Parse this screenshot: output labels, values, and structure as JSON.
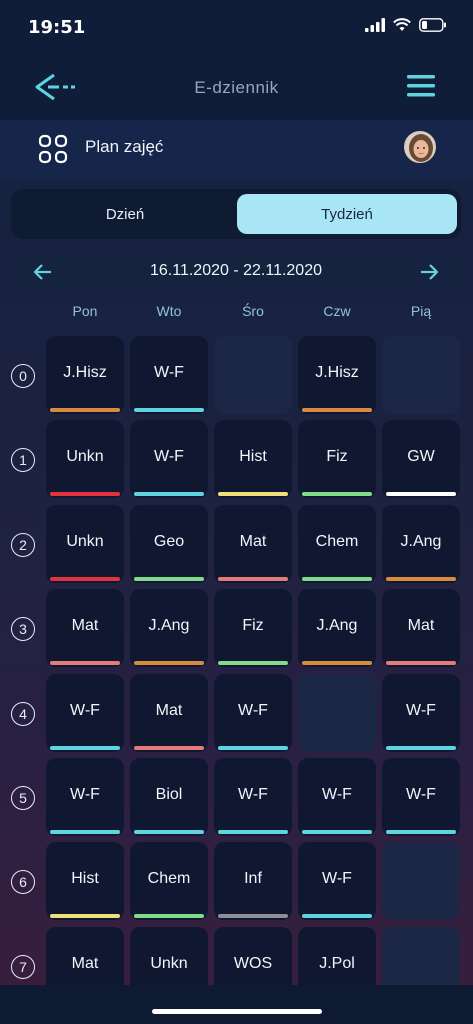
{
  "status": {
    "time": "19:51"
  },
  "header": {
    "title": "E-dziennik"
  },
  "subheader": {
    "title": "Plan zajęć"
  },
  "toggle": {
    "day_label": "Dzień",
    "week_label": "Tydzień",
    "active": "week"
  },
  "date_range": "16.11.2020 - 22.11.2020",
  "days": [
    "Pon",
    "Wto",
    "Śro",
    "Czw",
    "Pią"
  ],
  "lesson_numbers": [
    "0",
    "1",
    "2",
    "3",
    "4",
    "5",
    "6",
    "7"
  ],
  "colors": {
    "orange": "#d98a3d",
    "cyan": "#5fd4e0",
    "red": "#e0333d",
    "yellow": "#efe07a",
    "green": "#7fdc8a",
    "white": "#ffffff",
    "salmon": "#e57a7a",
    "gray": "#8a8f99",
    "accent": "#a8e6f5"
  },
  "timetable": [
    [
      {
        "label": "J.Hisz",
        "color": "orange"
      },
      {
        "label": "W-F",
        "color": "cyan"
      },
      null,
      {
        "label": "J.Hisz",
        "color": "orange"
      },
      null
    ],
    [
      {
        "label": "Unkn",
        "color": "red"
      },
      {
        "label": "W-F",
        "color": "cyan"
      },
      {
        "label": "Hist",
        "color": "yellow"
      },
      {
        "label": "Fiz",
        "color": "green"
      },
      {
        "label": "GW",
        "color": "white"
      }
    ],
    [
      {
        "label": "Unkn",
        "color": "red"
      },
      {
        "label": "Geo",
        "color": "green"
      },
      {
        "label": "Mat",
        "color": "salmon"
      },
      {
        "label": "Chem",
        "color": "green"
      },
      {
        "label": "J.Ang",
        "color": "orange"
      }
    ],
    [
      {
        "label": "Mat",
        "color": "salmon"
      },
      {
        "label": "J.Ang",
        "color": "orange"
      },
      {
        "label": "Fiz",
        "color": "green"
      },
      {
        "label": "J.Ang",
        "color": "orange"
      },
      {
        "label": "Mat",
        "color": "salmon"
      }
    ],
    [
      {
        "label": "W-F",
        "color": "cyan"
      },
      {
        "label": "Mat",
        "color": "salmon"
      },
      {
        "label": "W-F",
        "color": "cyan"
      },
      null,
      {
        "label": "W-F",
        "color": "cyan"
      }
    ],
    [
      {
        "label": "W-F",
        "color": "cyan"
      },
      {
        "label": "Biol",
        "color": "cyan"
      },
      {
        "label": "W-F",
        "color": "cyan"
      },
      {
        "label": "W-F",
        "color": "cyan"
      },
      {
        "label": "W-F",
        "color": "cyan"
      }
    ],
    [
      {
        "label": "Hist",
        "color": "yellow"
      },
      {
        "label": "Chem",
        "color": "green"
      },
      {
        "label": "Inf",
        "color": "gray"
      },
      {
        "label": "W-F",
        "color": "cyan"
      },
      null
    ],
    [
      {
        "label": "Mat",
        "color": null
      },
      {
        "label": "Unkn",
        "color": null
      },
      {
        "label": "WOS",
        "color": null
      },
      {
        "label": "J.Pol",
        "color": null
      },
      null
    ]
  ]
}
